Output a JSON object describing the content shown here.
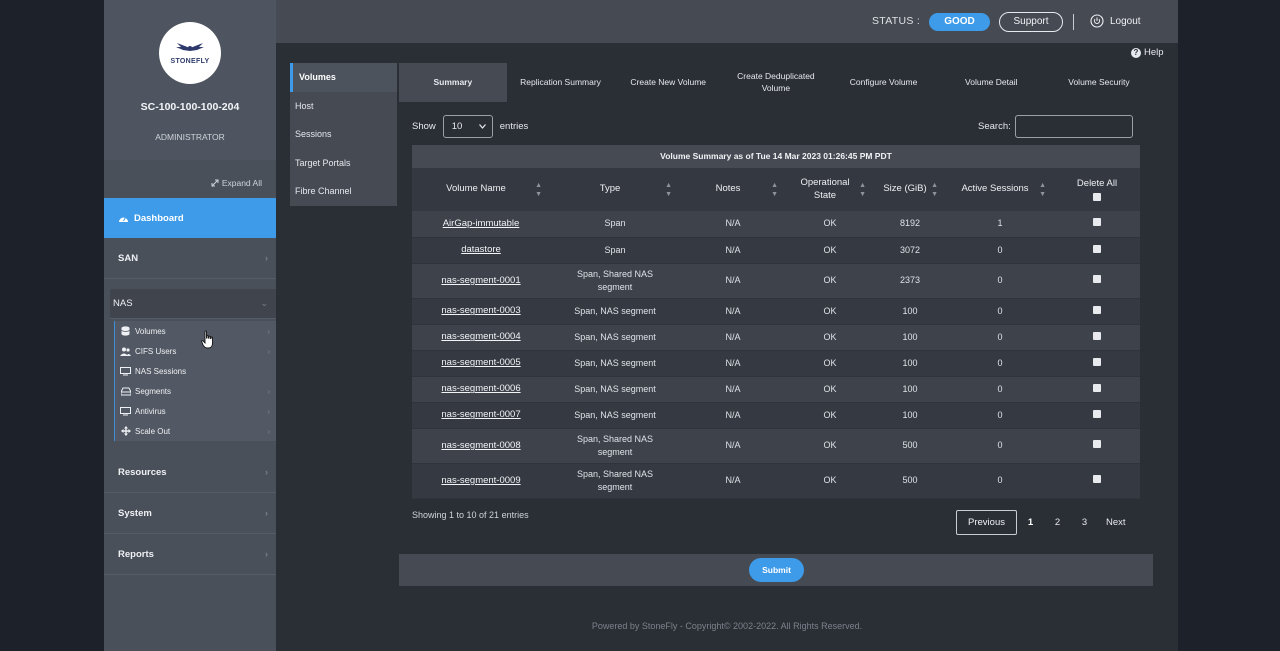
{
  "sidebar": {
    "logo_text": "STONEFLY",
    "hostname": "SC-100-100-100-204",
    "role": "ADMINISTRATOR",
    "expand_all": "Expand All",
    "dashboard": "Dashboard",
    "san": "SAN",
    "nas": "NAS",
    "nas_items": [
      {
        "label": "Volumes",
        "icon": "database-icon"
      },
      {
        "label": "CIFS Users",
        "icon": "users-icon"
      },
      {
        "label": "NAS Sessions",
        "icon": "monitor-icon"
      },
      {
        "label": "Segments",
        "icon": "drive-icon"
      },
      {
        "label": "Antivirus",
        "icon": "monitor-icon"
      },
      {
        "label": "Scale Out",
        "icon": "move-icon"
      }
    ],
    "resources": "Resources",
    "system": "System",
    "reports": "Reports"
  },
  "header": {
    "status_label": "STATUS :",
    "status_value": "GOOD",
    "support": "Support",
    "logout": "Logout"
  },
  "help": "Help",
  "subnav": [
    "Volumes",
    "Host",
    "Sessions",
    "Target Portals",
    "Fibre Channel"
  ],
  "tabs": [
    "Summary",
    "Replication Summary",
    "Create New Volume",
    "Create Deduplicated Volume",
    "Configure Volume",
    "Volume Detail",
    "Volume Security"
  ],
  "controls": {
    "show_label": "Show",
    "entries_value": "10",
    "entries_label": "entries",
    "search_label": "Search:",
    "search_value": ""
  },
  "table": {
    "caption": "Volume Summary as of Tue 14 Mar 2023 01:26:45 PM PDT",
    "columns": [
      "Volume Name",
      "Type",
      "Notes",
      "Operational State",
      "Size (GiB)",
      "Active Sessions",
      "Delete All"
    ],
    "rows": [
      [
        "AirGap-immutable",
        "Span",
        "N/A",
        "OK",
        "8192",
        "1"
      ],
      [
        "datastore",
        "Span",
        "N/A",
        "OK",
        "3072",
        "0"
      ],
      [
        "nas-segment-0001",
        "Span, Shared NAS segment",
        "N/A",
        "OK",
        "2373",
        "0"
      ],
      [
        "nas-segment-0003",
        "Span, NAS segment",
        "N/A",
        "OK",
        "100",
        "0"
      ],
      [
        "nas-segment-0004",
        "Span, NAS segment",
        "N/A",
        "OK",
        "100",
        "0"
      ],
      [
        "nas-segment-0005",
        "Span, NAS segment",
        "N/A",
        "OK",
        "100",
        "0"
      ],
      [
        "nas-segment-0006",
        "Span, NAS segment",
        "N/A",
        "OK",
        "100",
        "0"
      ],
      [
        "nas-segment-0007",
        "Span, NAS segment",
        "N/A",
        "OK",
        "100",
        "0"
      ],
      [
        "nas-segment-0008",
        "Span, Shared NAS segment",
        "N/A",
        "OK",
        "500",
        "0"
      ],
      [
        "nas-segment-0009",
        "Span, Shared NAS segment",
        "N/A",
        "OK",
        "500",
        "0"
      ]
    ]
  },
  "pagination": {
    "showing": "Showing 1 to 10 of 21 entries",
    "previous": "Previous",
    "pages": [
      "1",
      "2",
      "3"
    ],
    "next": "Next"
  },
  "submit": "Submit",
  "footer": "Powered by StoneFly - Copyright© 2002-2022. All Rights Reserved.",
  "colors": {
    "accent": "#3d9be9",
    "background": "#2a2e35",
    "sidebar": "#4a505a"
  }
}
